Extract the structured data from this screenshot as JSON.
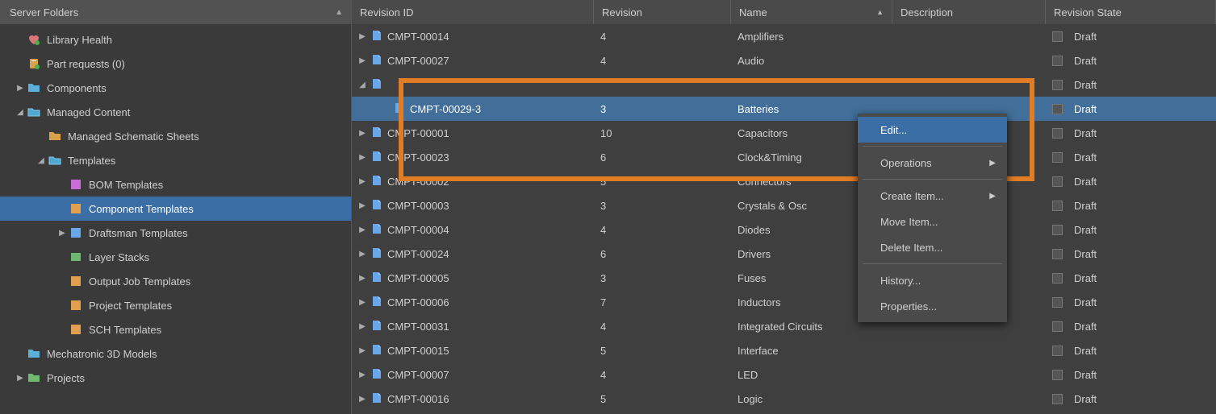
{
  "sidebar": {
    "title": "Server Folders",
    "items": [
      {
        "label": "Library Health"
      },
      {
        "label": "Part requests (0)"
      },
      {
        "label": "Components"
      },
      {
        "label": "Managed Content",
        "children": [
          {
            "label": "Managed Schematic Sheets"
          },
          {
            "label": "Templates",
            "children": [
              {
                "label": "BOM Templates"
              },
              {
                "label": "Component Templates",
                "selected": true
              },
              {
                "label": "Draftsman Templates"
              },
              {
                "label": "Layer Stacks"
              },
              {
                "label": "Output Job Templates"
              },
              {
                "label": "Project Templates"
              },
              {
                "label": "SCH Templates"
              }
            ]
          }
        ]
      },
      {
        "label": "Mechatronic 3D Models"
      },
      {
        "label": "Projects"
      }
    ]
  },
  "grid": {
    "columns": [
      "Revision ID",
      "Revision",
      "Name",
      "Description",
      "Revision State"
    ],
    "sort_column": "Name",
    "sort_dir": "asc",
    "rows": [
      {
        "id": "CMPT-00014",
        "rev": "4",
        "name": "Amplifiers",
        "desc": "",
        "state": "Draft",
        "exp": "▶"
      },
      {
        "id": "CMPT-00027",
        "rev": "4",
        "name": "Audio",
        "desc": "",
        "state": "Draft",
        "exp": "▶"
      },
      {
        "id": "",
        "rev": "",
        "name": "",
        "desc": "",
        "state": "Draft",
        "exp": "◢",
        "expanded": true
      },
      {
        "id": "CMPT-00029-3",
        "rev": "3",
        "name": "Batteries",
        "desc": "",
        "state": "Draft",
        "child": true,
        "selected": true
      },
      {
        "id": "CMPT-00001",
        "rev": "10",
        "name": "Capacitors",
        "desc": "",
        "state": "Draft",
        "exp": "▶"
      },
      {
        "id": "CMPT-00023",
        "rev": "6",
        "name": "Clock&Timing",
        "desc": "",
        "state": "Draft",
        "exp": "▶"
      },
      {
        "id": "CMPT-00002",
        "rev": "5",
        "name": "Connectors",
        "desc": "",
        "state": "Draft",
        "exp": "▶"
      },
      {
        "id": "CMPT-00003",
        "rev": "3",
        "name": "Crystals & Osc",
        "desc": "",
        "state": "Draft",
        "exp": "▶"
      },
      {
        "id": "CMPT-00004",
        "rev": "4",
        "name": "Diodes",
        "desc": "",
        "state": "Draft",
        "exp": "▶"
      },
      {
        "id": "CMPT-00024",
        "rev": "6",
        "name": "Drivers",
        "desc": "",
        "state": "Draft",
        "exp": "▶"
      },
      {
        "id": "CMPT-00005",
        "rev": "3",
        "name": "Fuses",
        "desc": "",
        "state": "Draft",
        "exp": "▶"
      },
      {
        "id": "CMPT-00006",
        "rev": "7",
        "name": "Inductors",
        "desc": "",
        "state": "Draft",
        "exp": "▶"
      },
      {
        "id": "CMPT-00031",
        "rev": "4",
        "name": "Integrated Circuits",
        "desc": "",
        "state": "Draft",
        "exp": "▶"
      },
      {
        "id": "CMPT-00015",
        "rev": "5",
        "name": "Interface",
        "desc": "",
        "state": "Draft",
        "exp": "▶"
      },
      {
        "id": "CMPT-00007",
        "rev": "4",
        "name": "LED",
        "desc": "",
        "state": "Draft",
        "exp": "▶"
      },
      {
        "id": "CMPT-00016",
        "rev": "5",
        "name": "Logic",
        "desc": "",
        "state": "Draft",
        "exp": "▶"
      }
    ]
  },
  "context_menu": [
    {
      "label": "Edit...",
      "highlighted": true
    },
    {
      "label": "Operations",
      "submenu": true
    },
    {
      "label": "Create Item...",
      "submenu": true
    },
    {
      "label": "Move Item..."
    },
    {
      "label": "Delete Item..."
    },
    {
      "label": "History..."
    },
    {
      "label": "Properties..."
    }
  ],
  "highlight_color": "#e07c24",
  "selection_color": "#3b6ea5"
}
